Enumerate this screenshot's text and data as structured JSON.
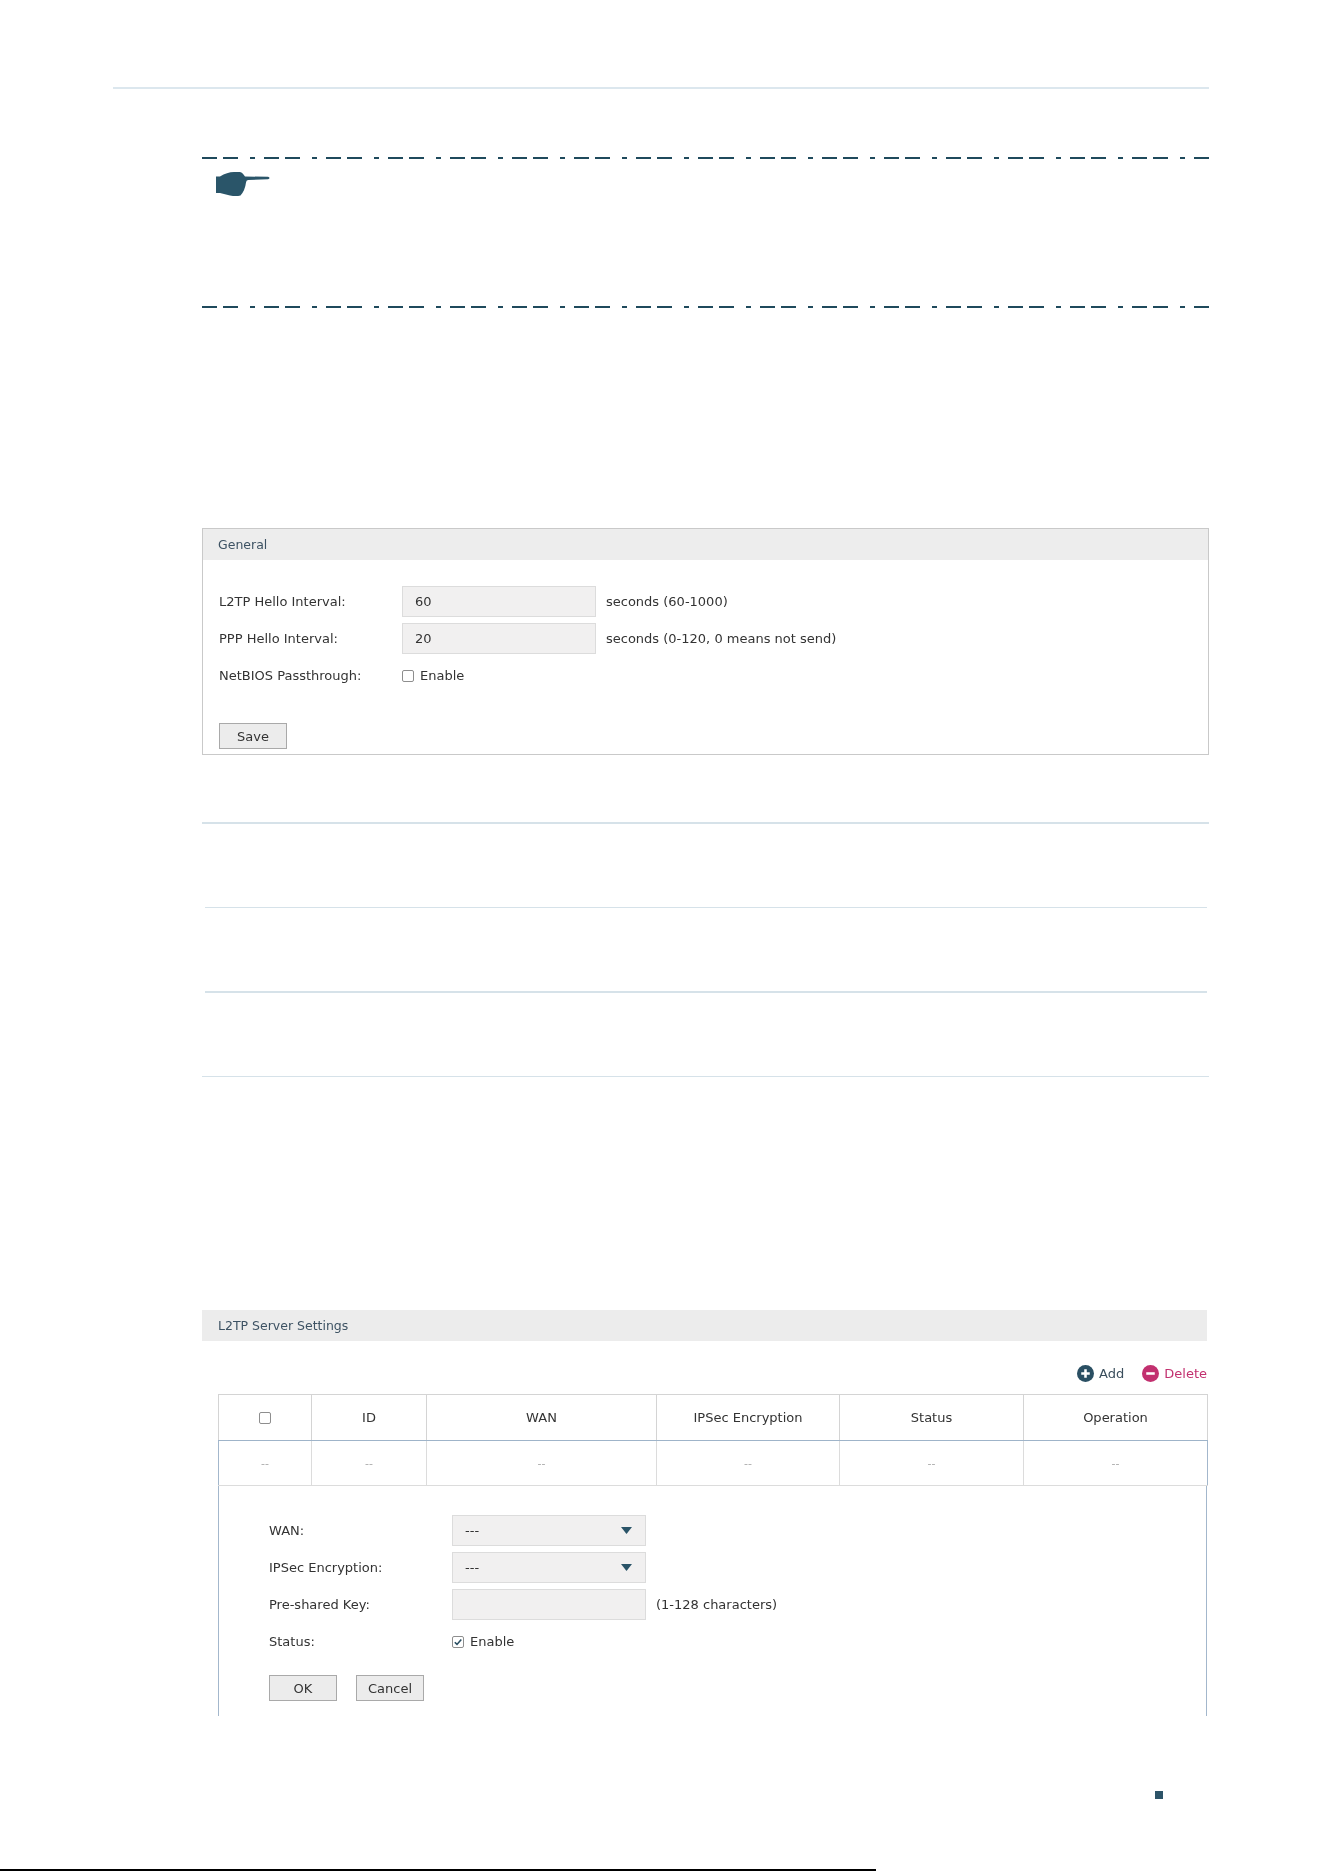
{
  "general": {
    "title": "General",
    "fields": [
      {
        "kind": "number",
        "label": "L2TP Hello Interval:",
        "value": "60",
        "hint": "seconds (60-1000)"
      },
      {
        "kind": "number",
        "label": "PPP Hello Interval:",
        "value": "20",
        "hint": "seconds (0-120, 0 means not send)"
      },
      {
        "kind": "checkbox",
        "label": "NetBIOS Passthrough:",
        "option": "Enable",
        "checked": false
      }
    ],
    "save_button": "Save"
  },
  "l2tp_server": {
    "title": "L2TP Server Settings",
    "actions": [
      {
        "kind": "add",
        "label": "Add"
      },
      {
        "kind": "delete",
        "label": "Delete"
      }
    ],
    "table": {
      "columns": [
        {
          "kind": "select_all",
          "checked": false
        },
        {
          "kind": "text",
          "label": "ID"
        },
        {
          "kind": "text",
          "label": "WAN"
        },
        {
          "kind": "text",
          "label": "IPSec Encryption"
        },
        {
          "kind": "text",
          "label": "Status"
        },
        {
          "kind": "text",
          "label": "Operation"
        }
      ],
      "rows": [
        {
          "cells": [
            "--",
            "--",
            "--",
            "--",
            "--",
            "--"
          ]
        }
      ]
    },
    "form": {
      "fields": [
        {
          "kind": "select",
          "label": "WAN:",
          "value": "---"
        },
        {
          "kind": "select",
          "label": "IPSec Encryption:",
          "value": "---"
        },
        {
          "kind": "text",
          "label": "Pre-shared Key:",
          "hint": "(1-128 characters)"
        },
        {
          "kind": "checkbox",
          "label": "Status:",
          "option": "Enable",
          "checked": true
        }
      ],
      "buttons": [
        "OK",
        "Cancel"
      ]
    }
  }
}
